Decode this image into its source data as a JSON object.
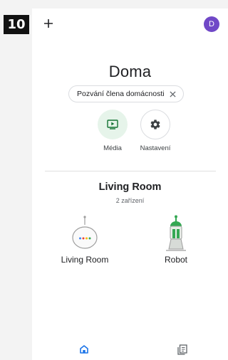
{
  "step_badge": "10",
  "header": {
    "add_icon": "plus-icon",
    "avatar_initial": "D",
    "avatar_color": "#7048c7"
  },
  "home": {
    "title": "Doma",
    "invite_chip": {
      "label": "Pozvání člena domácnosti",
      "close_icon": "close-icon"
    }
  },
  "actions": [
    {
      "label": "Média",
      "icon": "media-play-icon",
      "bg": "#e6f4ea",
      "icon_color": "#137333"
    },
    {
      "label": "Nastavení",
      "icon": "settings-gear-icon",
      "bg": "#ffffff",
      "icon_color": "#3c4043"
    }
  ],
  "room": {
    "name": "Living Room",
    "device_count": "2 zařízení",
    "devices": [
      {
        "label": "Living Room",
        "icon": "google-home-mini-icon"
      },
      {
        "label": "Robot",
        "icon": "robot-icon"
      }
    ]
  },
  "bottom_nav": [
    {
      "icon": "home-icon",
      "active": true,
      "color": "#1a73e8"
    },
    {
      "icon": "feed-icon",
      "active": false,
      "color": "#5f6368"
    }
  ]
}
